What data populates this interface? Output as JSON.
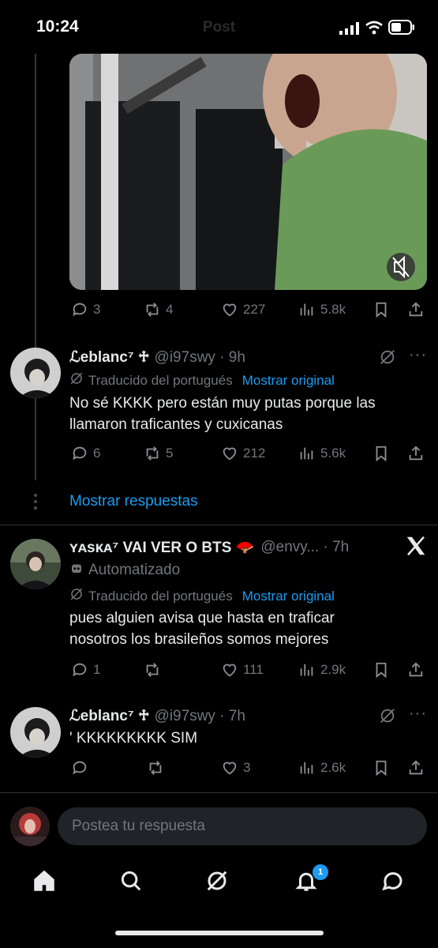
{
  "status_bar": {
    "time": "10:24",
    "title_ghost": "Post"
  },
  "post1": {
    "stats": {
      "replies": "3",
      "reposts": "4",
      "likes": "227",
      "views": "5.8k"
    }
  },
  "reply1": {
    "name": "ℒeblanc⁷ ♱",
    "handle": "@i97swy · 9h",
    "translated": "Traducido del portugués",
    "show_original": "Mostrar original",
    "text": "No sé KKKK pero están muy putas porque las llamaron traficantes y cuxicanas",
    "stats": {
      "replies": "6",
      "reposts": "5",
      "likes": "212",
      "views": "5.6k"
    }
  },
  "show_replies": "Mostrar respuestas",
  "post2": {
    "name": "ʏᴀsᴋᴀ⁷ VAI VER O BTS 🪭",
    "handle": "@envy... · 7h",
    "automated": "Automatizado",
    "translated": "Traducido del portugués",
    "show_original": "Mostrar original",
    "text": "pues alguien avisa que hasta en traficar nosotros los brasileños somos mejores",
    "stats": {
      "replies": "1",
      "reposts": "",
      "likes": "111",
      "views": "2.9k"
    }
  },
  "reply2": {
    "name": "ℒeblanc⁷ ♱",
    "handle": "@i97swy · 7h",
    "text": "' KKKKKKKKK SIM",
    "stats": {
      "replies": "",
      "reposts": "",
      "likes": "3",
      "views": "2.6k"
    }
  },
  "compose": {
    "placeholder": "Postea tu respuesta"
  },
  "nav": {
    "notifications_badge": "1"
  },
  "colors": {
    "accent": "#1d9bf0",
    "background": "#000000",
    "muted": "#71767b"
  }
}
